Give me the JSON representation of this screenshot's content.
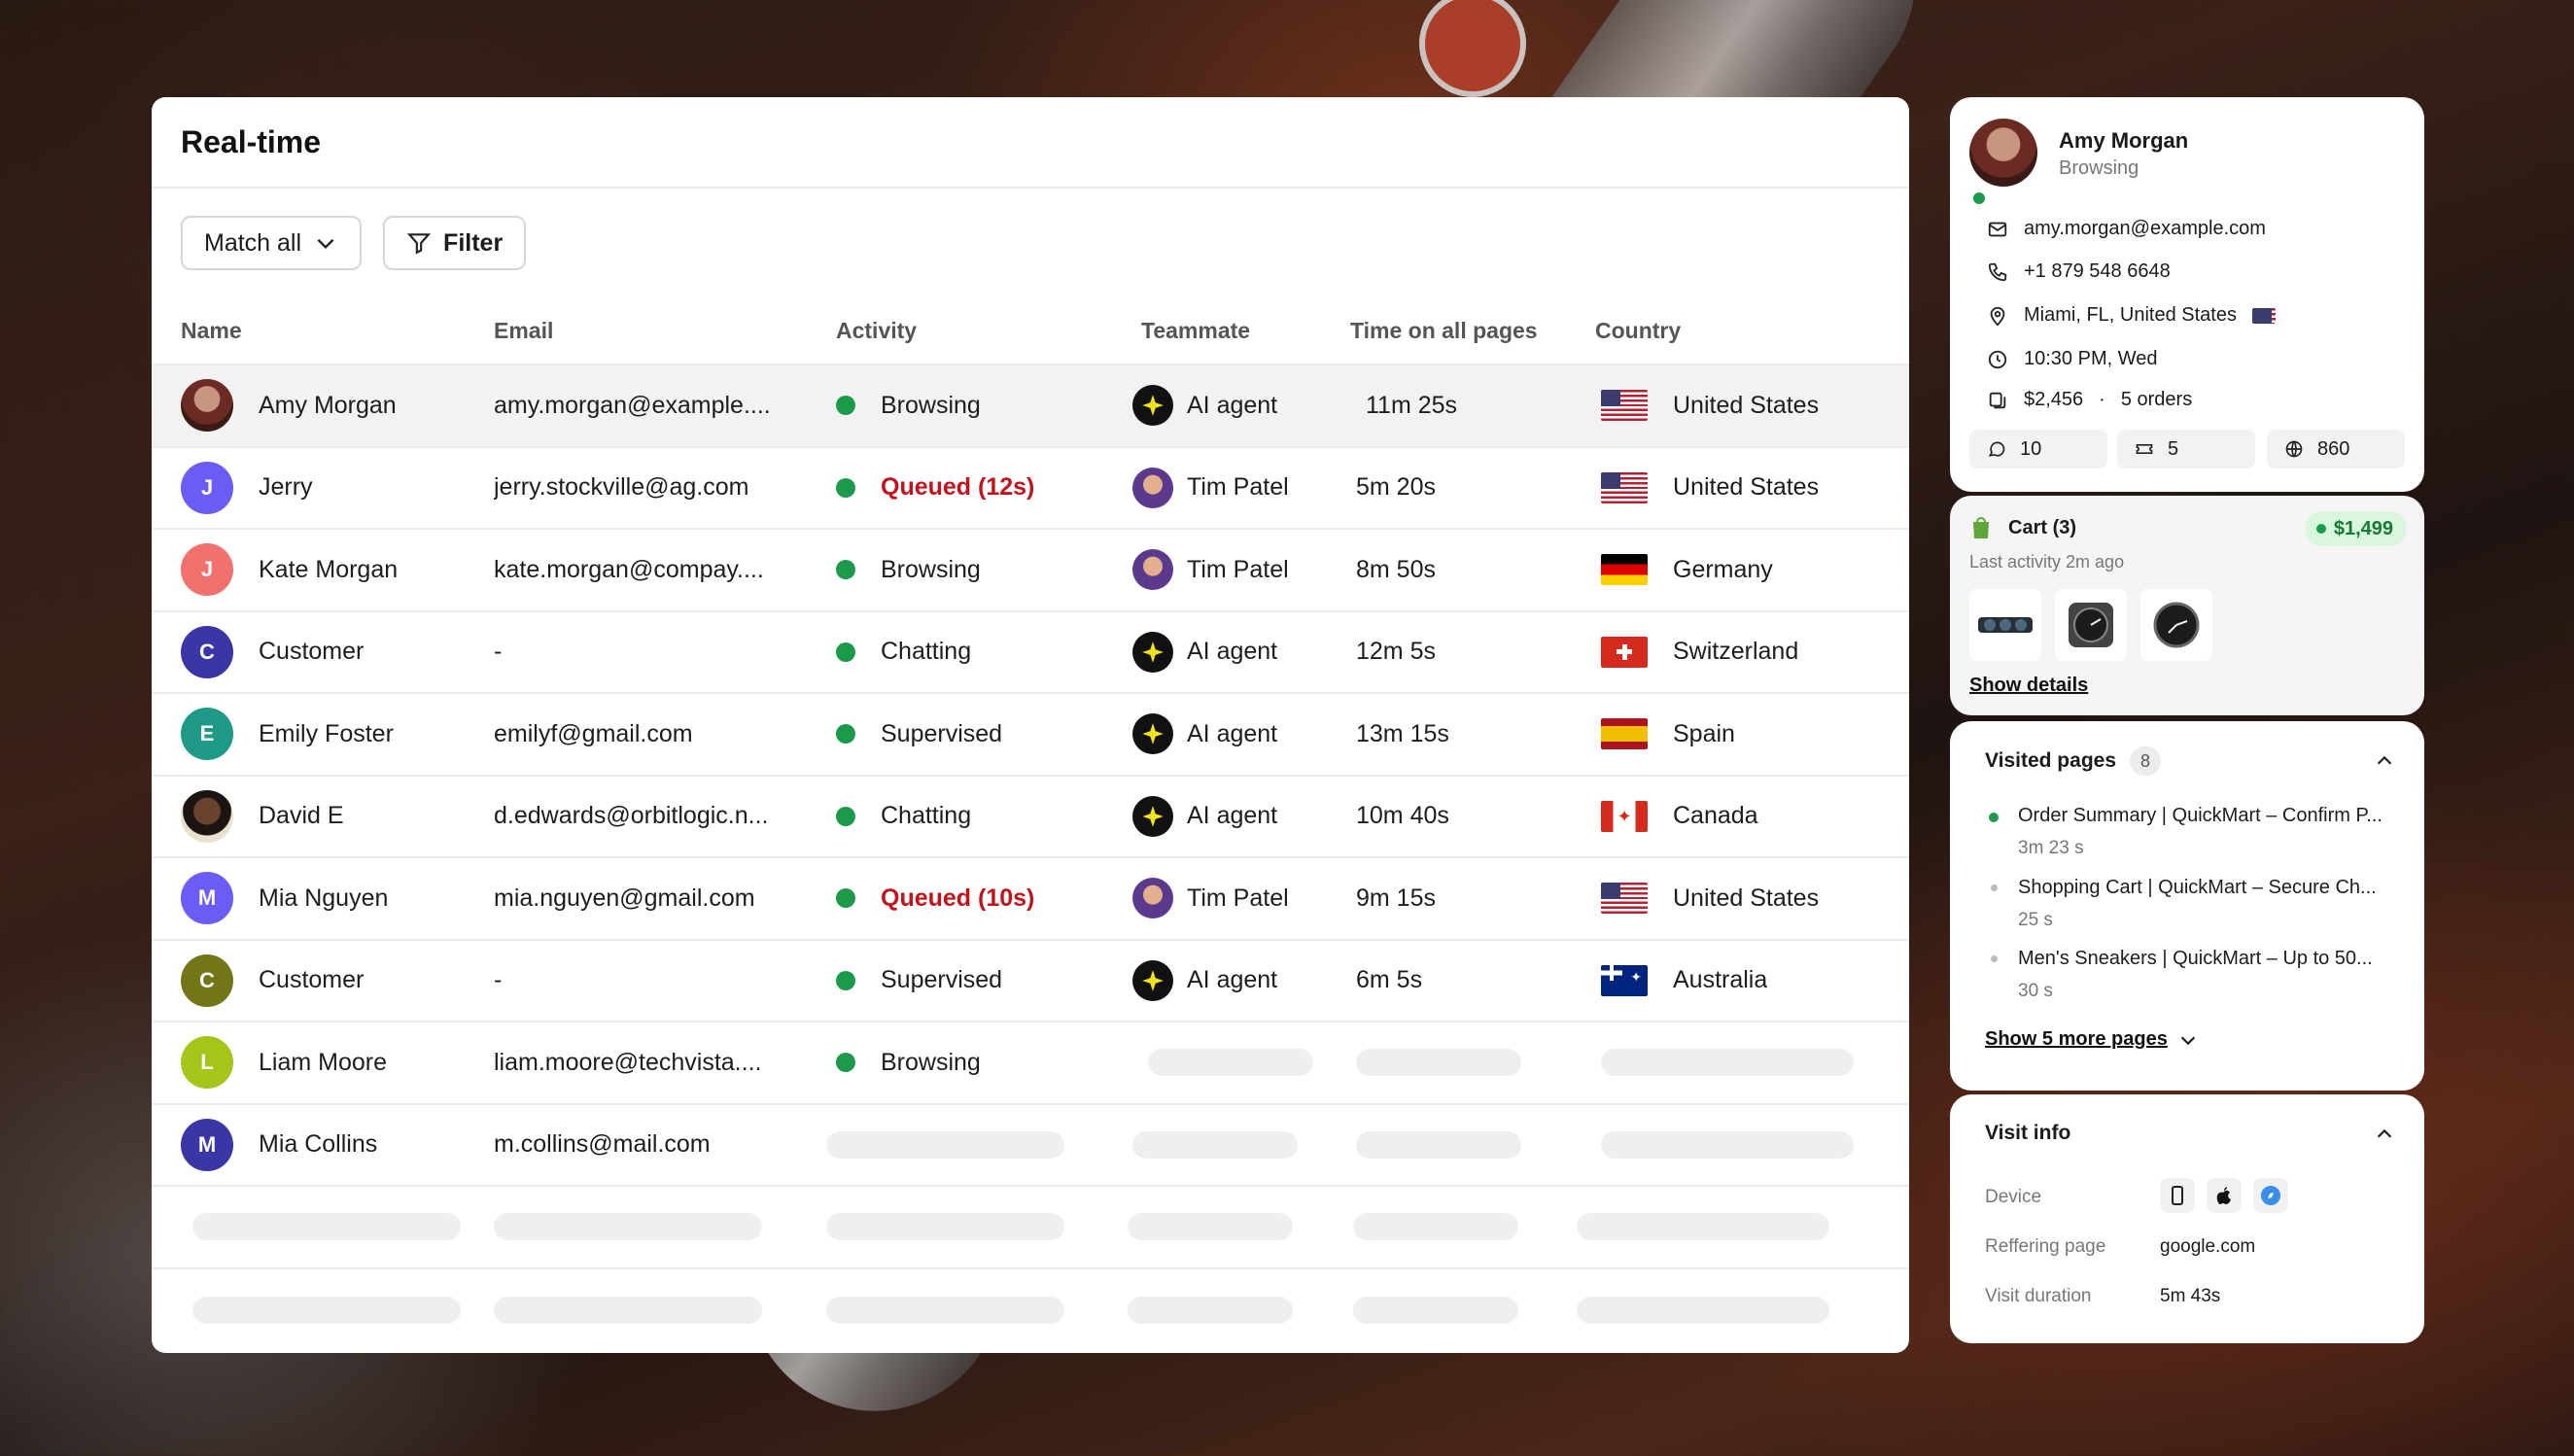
{
  "table": {
    "title": "Real-time",
    "match_label": "Match all",
    "filter_label": "Filter",
    "columns": [
      "Name",
      "Email",
      "Activity",
      "Teammate",
      "Time on all pages",
      "Country"
    ],
    "rows": [
      {
        "name": "Amy Morgan",
        "initial": "",
        "avatar_color": "",
        "email": "amy.morgan@example....",
        "activity": "Browsing",
        "teammate": "AI agent",
        "time": "11m 25s",
        "country": "United States",
        "flag": "us"
      },
      {
        "name": "Jerry",
        "initial": "J",
        "avatar_color": "#6b5cf6",
        "email": "jerry.stockville@ag.com",
        "activity": "Queued (12s)",
        "teammate": "Tim Patel",
        "time": "5m 20s",
        "country": "United States",
        "flag": "us"
      },
      {
        "name": "Kate Morgan",
        "initial": "J",
        "avatar_color": "#f0716d",
        "email": "kate.morgan@compay....",
        "activity": "Browsing",
        "teammate": "Tim Patel",
        "time": "8m 50s",
        "country": "Germany",
        "flag": "de"
      },
      {
        "name": "Customer",
        "initial": "C",
        "avatar_color": "#3b36a6",
        "email": "-",
        "activity": "Chatting",
        "teammate": "AI agent",
        "time": "12m 5s",
        "country": "Switzerland",
        "flag": "ch"
      },
      {
        "name": "Emily Foster",
        "initial": "E",
        "avatar_color": "#1e9a86",
        "email": "emilyf@gmail.com",
        "activity": "Supervised",
        "teammate": "AI agent",
        "time": "13m 15s",
        "country": "Spain",
        "flag": "es"
      },
      {
        "name": "David E",
        "initial": "",
        "avatar_color": "",
        "email": "d.edwards@orbitlogic.n...",
        "activity": "Chatting",
        "teammate": "AI agent",
        "time": "10m 40s",
        "country": "Canada",
        "flag": "ca"
      },
      {
        "name": "Mia Nguyen",
        "initial": "M",
        "avatar_color": "#6b5cf6",
        "email": "mia.nguyen@gmail.com",
        "activity": "Queued (10s)",
        "teammate": "Tim Patel",
        "time": "9m 15s",
        "country": "United States",
        "flag": "us"
      },
      {
        "name": "Customer",
        "initial": "C",
        "avatar_color": "#727617",
        "email": "-",
        "activity": "Supervised",
        "teammate": "AI agent",
        "time": "6m 5s",
        "country": "Australia",
        "flag": "au"
      },
      {
        "name": "Liam Moore",
        "initial": "L",
        "avatar_color": "#a6c51a",
        "email": "liam.moore@techvista....",
        "activity": "Browsing",
        "teammate": "",
        "time": "",
        "country": "",
        "flag": ""
      },
      {
        "name": "Mia Collins",
        "initial": "M",
        "avatar_color": "#3b36a6",
        "email": "m.collins@mail.com",
        "activity": "",
        "teammate": "",
        "time": "",
        "country": "",
        "flag": ""
      }
    ]
  },
  "profile": {
    "name": "Amy Morgan",
    "status": "Browsing",
    "email": "amy.morgan@example.com",
    "phone": "+1 879 548 6648",
    "location": "Miami, FL, United States",
    "local_time": "10:30 PM, Wed",
    "spent": "$2,456",
    "separator": "·",
    "orders": "5 orders",
    "stats": {
      "chats": "10",
      "tickets": "5",
      "visits": "860"
    }
  },
  "cart": {
    "title": "Cart (3)",
    "total": "$1,499",
    "last_activity": "Last activity 2m ago",
    "show_details": "Show details"
  },
  "visited": {
    "title": "Visited pages",
    "count": "8",
    "pages": [
      {
        "title": "Order Summary | QuickMart – Confirm P...",
        "duration": "3m 23 s"
      },
      {
        "title": "Shopping Cart | QuickMart – Secure Ch...",
        "duration": "25 s"
      },
      {
        "title": "Men's Sneakers | QuickMart – Up to 50...",
        "duration": "30 s"
      }
    ],
    "show_more": "Show 5 more pages"
  },
  "visit_info": {
    "title": "Visit info",
    "device_label": "Device",
    "referring_label": "Reffering page",
    "referring_value": "google.com",
    "duration_label": "Visit duration",
    "duration_value": "5m 43s"
  },
  "colors": {
    "online": "#1b9a4b",
    "queued": "#c0141c",
    "cart_badge_bg": "#d9f7dd",
    "cart_badge_text": "#167a33"
  }
}
